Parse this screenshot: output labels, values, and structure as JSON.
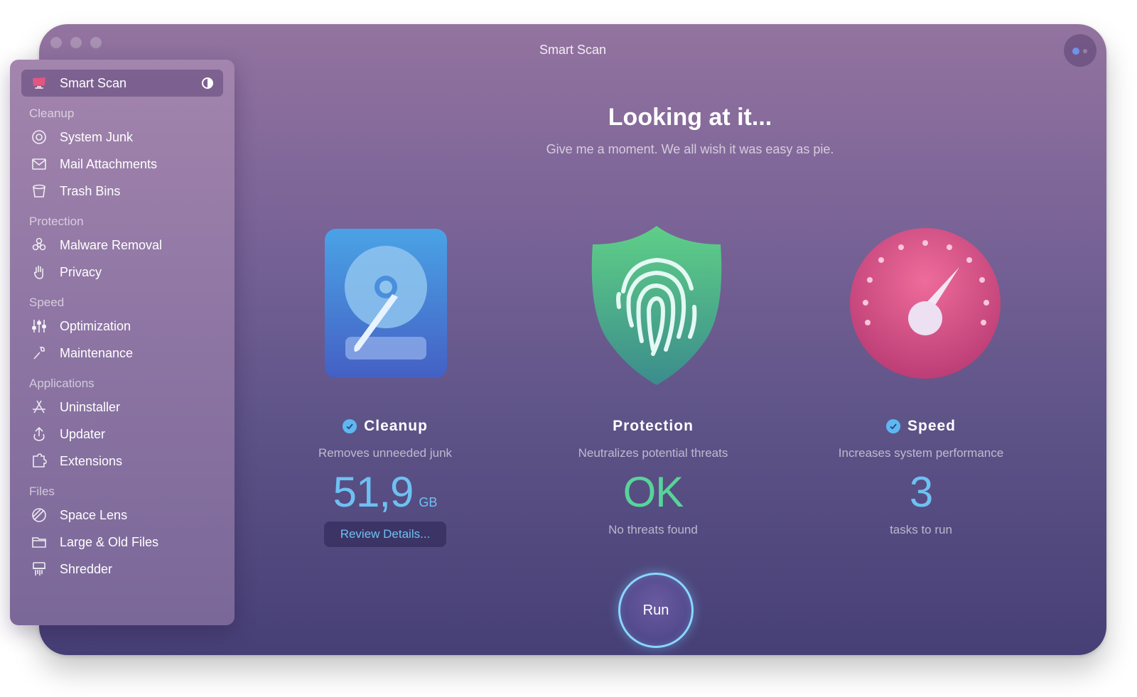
{
  "window": {
    "title": "Smart Scan"
  },
  "sidebar": {
    "active_item": {
      "label": "Smart Scan",
      "icon": "monitor-icon"
    },
    "sections": [
      {
        "label": "Cleanup",
        "items": [
          {
            "label": "System Junk",
            "icon": "trash-disc-icon"
          },
          {
            "label": "Mail Attachments",
            "icon": "envelope-icon"
          },
          {
            "label": "Trash Bins",
            "icon": "bin-icon"
          }
        ]
      },
      {
        "label": "Protection",
        "items": [
          {
            "label": "Malware Removal",
            "icon": "biohazard-icon"
          },
          {
            "label": "Privacy",
            "icon": "hand-icon"
          }
        ]
      },
      {
        "label": "Speed",
        "items": [
          {
            "label": "Optimization",
            "icon": "sliders-icon"
          },
          {
            "label": "Maintenance",
            "icon": "wrench-icon"
          }
        ]
      },
      {
        "label": "Applications",
        "items": [
          {
            "label": "Uninstaller",
            "icon": "app-store-icon"
          },
          {
            "label": "Updater",
            "icon": "update-arrow-icon"
          },
          {
            "label": "Extensions",
            "icon": "puzzle-icon"
          }
        ]
      },
      {
        "label": "Files",
        "items": [
          {
            "label": "Space Lens",
            "icon": "lens-icon"
          },
          {
            "label": "Large & Old Files",
            "icon": "folder-icon"
          },
          {
            "label": "Shredder",
            "icon": "shredder-icon"
          }
        ]
      }
    ]
  },
  "main": {
    "heading": "Looking at it...",
    "subheading": "Give me a moment. We all wish it was easy as pie.",
    "cards": {
      "cleanup": {
        "title": "Cleanup",
        "desc": "Removes unneeded junk",
        "value": "51,9",
        "unit": "GB",
        "button": "Review Details...",
        "value_color": "#6ec1f2"
      },
      "protection": {
        "title": "Protection",
        "desc": "Neutralizes potential threats",
        "value": "OK",
        "note": "No threats found",
        "value_color": "#58d49a"
      },
      "speed": {
        "title": "Speed",
        "desc": "Increases system performance",
        "value": "3",
        "note": "tasks to run",
        "value_color": "#6ec1f2"
      }
    },
    "run_button": "Run"
  }
}
